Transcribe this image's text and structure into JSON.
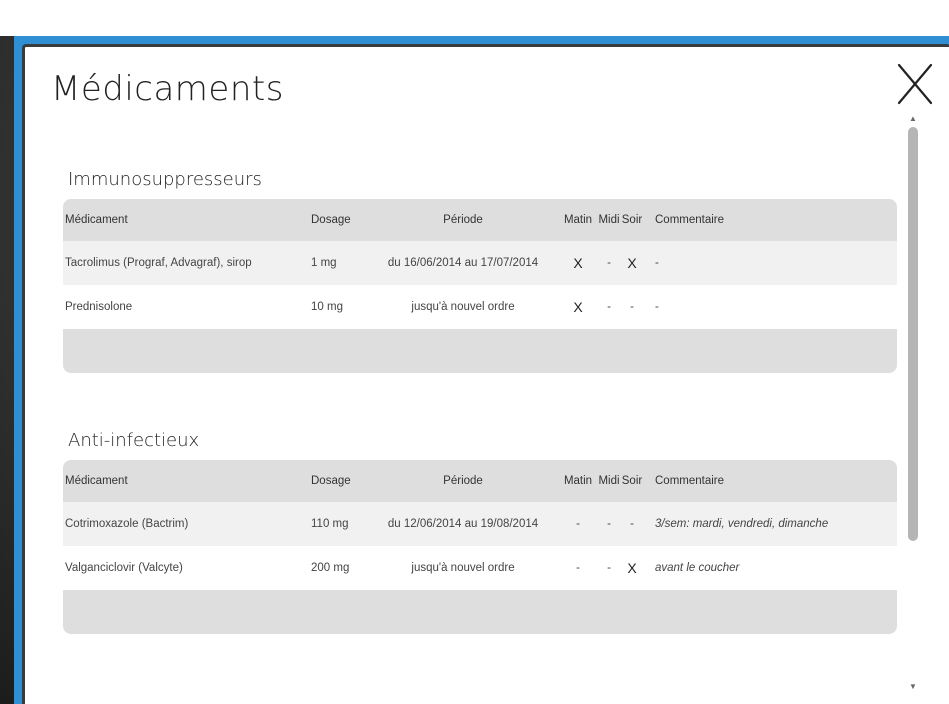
{
  "modal": {
    "title": "Médicaments",
    "close_glyph": "X"
  },
  "columns": {
    "medicament": "Médicament",
    "dosage": "Dosage",
    "periode": "Période",
    "matin": "Matin",
    "midi": "Midi",
    "soir": "Soir",
    "commentaire": "Commentaire"
  },
  "sections": [
    {
      "title": "Immunosuppresseurs",
      "rows": [
        {
          "medicament": "Tacrolimus (Prograf, Advagraf), sirop",
          "dosage": "1 mg",
          "periode": "du 16/06/2014 au 17/07/2014",
          "matin": "X",
          "midi": "-",
          "soir": "X",
          "commentaire": "-"
        },
        {
          "medicament": "Prednisolone",
          "dosage": "10 mg",
          "periode": "jusqu'à nouvel ordre",
          "matin": "X",
          "midi": "-",
          "soir": "-",
          "commentaire": "-"
        }
      ]
    },
    {
      "title": "Anti-infectieux",
      "rows": [
        {
          "medicament": "Cotrimoxazole (Bactrim)",
          "dosage": "110 mg",
          "periode": "du 12/06/2014 au 19/08/2014",
          "matin": "-",
          "midi": "-",
          "soir": "-",
          "commentaire": "3/sem: mardi, vendredi, dimanche"
        },
        {
          "medicament": "Valganciclovir (Valcyte)",
          "dosage": "200 mg",
          "periode": "jusqu'à nouvel ordre",
          "matin": "-",
          "midi": "-",
          "soir": "X",
          "commentaire": "avant le coucher"
        }
      ]
    }
  ],
  "colors": {
    "frame_blue": "#2f8fd4",
    "header_gray": "#dedede",
    "row_alt": "#f1f1f1"
  }
}
